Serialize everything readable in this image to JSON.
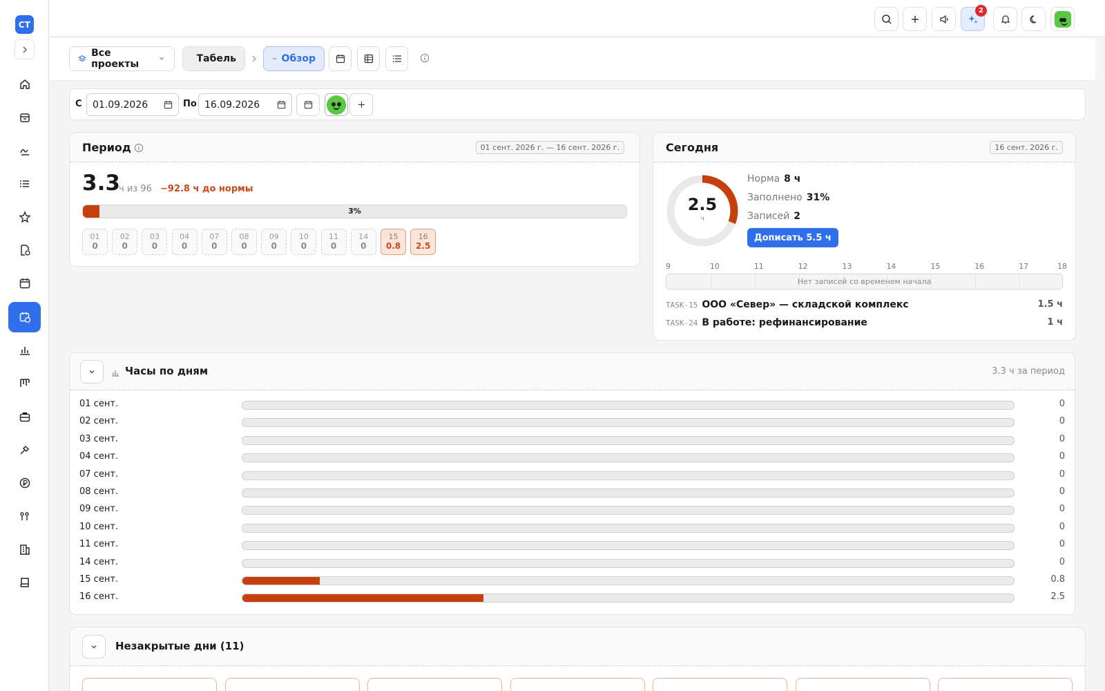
{
  "sidebar": {
    "logo": "СТ",
    "items": [
      {
        "name": "home-icon"
      },
      {
        "name": "archive-icon"
      },
      {
        "name": "signature-icon"
      },
      {
        "name": "list-icon"
      },
      {
        "name": "star-icon"
      },
      {
        "name": "document-clock-icon"
      },
      {
        "name": "calendar-icon"
      },
      {
        "name": "calendar-clock-icon",
        "active": true
      },
      {
        "name": "bar-chart-icon"
      },
      {
        "name": "kanban-icon"
      },
      {
        "name": "briefcase-icon"
      },
      {
        "name": "tools-icon"
      },
      {
        "name": "ruble-icon"
      },
      {
        "name": "people-icon"
      },
      {
        "name": "building-icon"
      },
      {
        "name": "book-icon"
      }
    ]
  },
  "topbar": {
    "notifications_badge": "2"
  },
  "toolbar": {
    "projects": "Все проекты",
    "tabel": "Табель",
    "overview": "Обзор"
  },
  "filters": {
    "from_label": "С",
    "from_value": "01.09.2026",
    "to_label": "По",
    "to_value": "16.09.2026"
  },
  "period": {
    "title": "Период",
    "range": "01 сент. 2026 г. — 16 сент. 2026 г.",
    "total": "3.3",
    "of_text": "ч из 96",
    "deficit": "−92.8 ч до нормы",
    "progress_percent": 3,
    "progress_label": "3%",
    "days": [
      {
        "d": "01",
        "v": "0"
      },
      {
        "d": "02",
        "v": "0"
      },
      {
        "d": "03",
        "v": "0"
      },
      {
        "d": "04",
        "v": "0"
      },
      {
        "d": "07",
        "v": "0"
      },
      {
        "d": "08",
        "v": "0"
      },
      {
        "d": "09",
        "v": "0"
      },
      {
        "d": "10",
        "v": "0"
      },
      {
        "d": "11",
        "v": "0"
      },
      {
        "d": "14",
        "v": "0"
      },
      {
        "d": "15",
        "v": "0.8",
        "filled": true
      },
      {
        "d": "16",
        "v": "2.5",
        "filled": true
      }
    ]
  },
  "today": {
    "title": "Сегодня",
    "date": "16 сент. 2026 г.",
    "value": "2.5",
    "unit": "ч",
    "fill_fraction": 0.31,
    "norm_label": "Норма",
    "norm_value": "8 ч",
    "filled_label": "Заполнено",
    "filled_value": "31%",
    "records_label": "Записей",
    "records_value": "2",
    "add_button": "Дописать 5.5 ч",
    "hours": [
      "9",
      "10",
      "11",
      "12",
      "13",
      "14",
      "15",
      "16",
      "17",
      "18"
    ],
    "timeline_empty": "Нет записей со временем начала",
    "tasks": [
      {
        "code": "TASK-15",
        "title": "ООО «Север» — складской комплекс",
        "hours": "1.5 ч"
      },
      {
        "code": "TASK-24",
        "title": "В работе: рефинансирование",
        "hours": "1 ч"
      }
    ]
  },
  "hours_by_day": {
    "title": "Часы по дням",
    "summary": "3.3 ч за период",
    "max": 8,
    "rows": [
      {
        "label": "01 сент.",
        "value": 0,
        "text": "0"
      },
      {
        "label": "02 сент.",
        "value": 0,
        "text": "0"
      },
      {
        "label": "03 сент.",
        "value": 0,
        "text": "0"
      },
      {
        "label": "04 сент.",
        "value": 0,
        "text": "0"
      },
      {
        "label": "07 сент.",
        "value": 0,
        "text": "0"
      },
      {
        "label": "08 сент.",
        "value": 0,
        "text": "0"
      },
      {
        "label": "09 сент.",
        "value": 0,
        "text": "0"
      },
      {
        "label": "10 сент.",
        "value": 0,
        "text": "0"
      },
      {
        "label": "11 сент.",
        "value": 0,
        "text": "0"
      },
      {
        "label": "14 сент.",
        "value": 0,
        "text": "0"
      },
      {
        "label": "15 сент.",
        "value": 0.8,
        "text": "0.8"
      },
      {
        "label": "16 сент.",
        "value": 2.5,
        "text": "2.5"
      }
    ]
  },
  "unclosed": {
    "title": "Незакрытые дни (11)"
  },
  "colors": {
    "accent": "#2f6fec",
    "fill": "#c6400f",
    "warn": "#c84a18"
  }
}
